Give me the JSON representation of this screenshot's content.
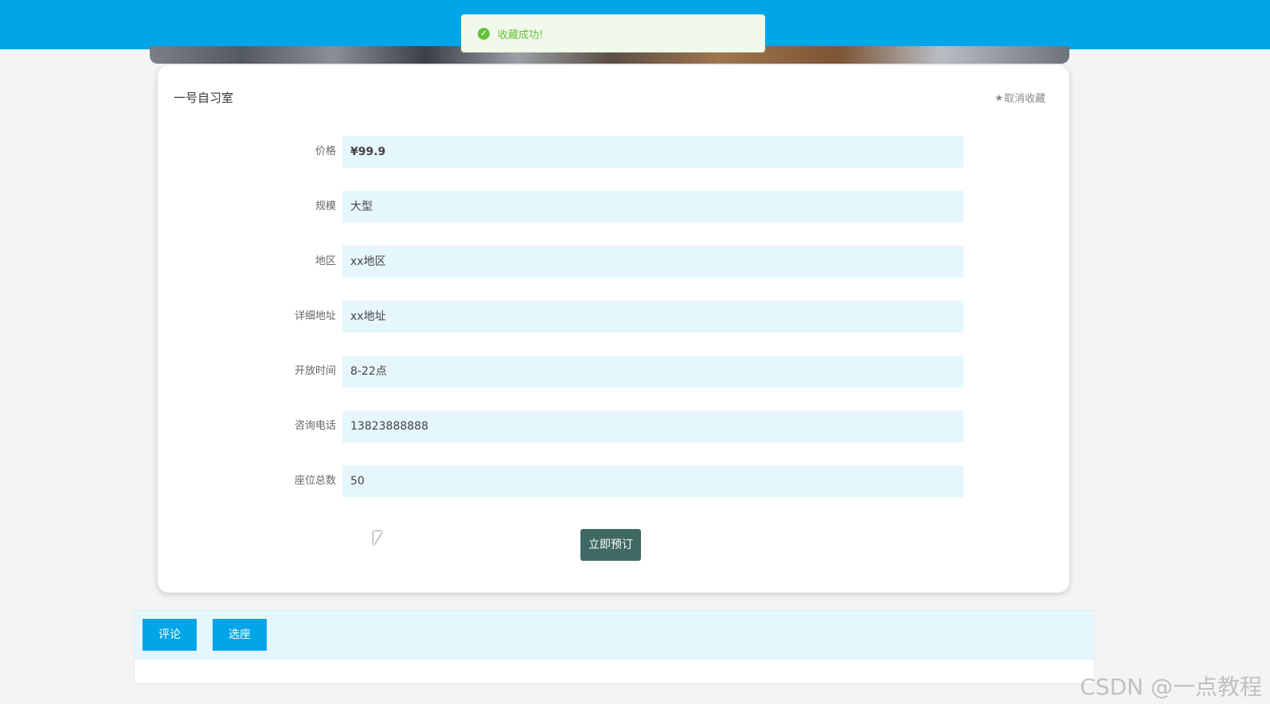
{
  "toast": {
    "message": "收藏成功!",
    "color": "#67c23a"
  },
  "detail": {
    "title": "一号自习室",
    "unfavorite_label": "取消收藏",
    "fields": [
      {
        "label": "价格",
        "value": "¥99.9"
      },
      {
        "label": "规模",
        "value": "大型"
      },
      {
        "label": "地区",
        "value": "xx地区"
      },
      {
        "label": "详细地址",
        "value": "xx地址"
      },
      {
        "label": "开放时间",
        "value": "8-22点"
      },
      {
        "label": "咨询电话",
        "value": "13823888888"
      },
      {
        "label": "座位总数",
        "value": "50"
      }
    ],
    "book_button": "立即预订"
  },
  "tabs": [
    {
      "label": "评论"
    },
    {
      "label": "选座"
    }
  ],
  "colors": {
    "topbar": "#00a6e8",
    "field_bg": "#e6f6fd",
    "book_button": "#3f6a64"
  },
  "watermark": "CSDN @一点教程"
}
